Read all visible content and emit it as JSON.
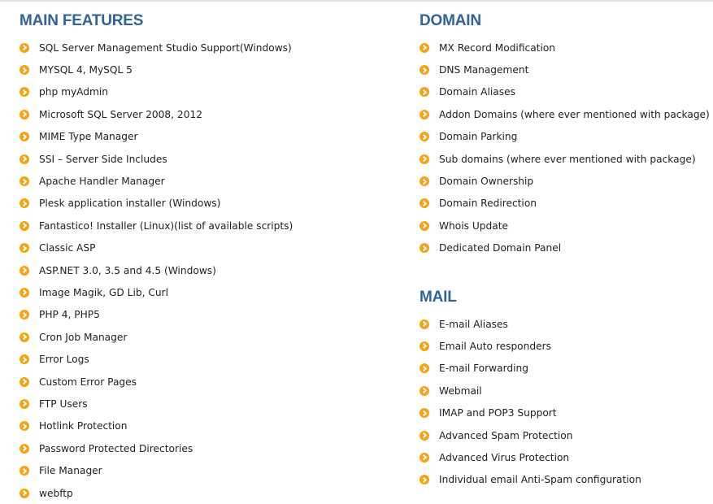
{
  "main_features": {
    "title": "MAIN FEATURES",
    "items": [
      "SQL Server Management Studio Support(Windows)",
      "MYSQL 4, MySQL 5",
      "php myAdmin",
      "Microsoft SQL Server 2008, 2012",
      "MIME Type Manager",
      "SSI – Server Side Includes",
      "Apache Handler Manager",
      "Plesk application installer (Windows)",
      "Fantastico! Installer (Linux)(list of available scripts)",
      "Classic ASP",
      "ASP.NET 3.0, 3.5 and 4.5 (Windows)",
      "Image Magik, GD Lib, Curl",
      "PHP 4, PHP5",
      "Cron Job Manager",
      "Error Logs",
      "Custom Error Pages",
      "FTP Users",
      "Hotlink Protection",
      "Password Protected Directories",
      "File Manager",
      "webftp"
    ]
  },
  "domain": {
    "title": "DOMAIN",
    "items": [
      "MX Record Modification",
      "DNS Management",
      "Domain Aliases",
      "Addon Domains (where ever mentioned with package)",
      "Domain Parking",
      "Sub domains (where ever mentioned with package)",
      "Domain Ownership",
      "Domain Redirection",
      "Whois Update",
      "Dedicated Domain Panel"
    ]
  },
  "mail": {
    "title": "MAIL",
    "items": [
      "E-mail Aliases",
      "Email Auto responders",
      "E-mail Forwarding",
      "Webmail",
      "IMAP and POP3 Support",
      "Advanced Spam Protection",
      "Advanced Virus Protection",
      "Individual email Anti-Spam configuration"
    ]
  },
  "icon": "chevron-circle-right-icon",
  "colors": {
    "heading": "#30649c",
    "bullet": "#f6a316",
    "text": "#222222"
  }
}
